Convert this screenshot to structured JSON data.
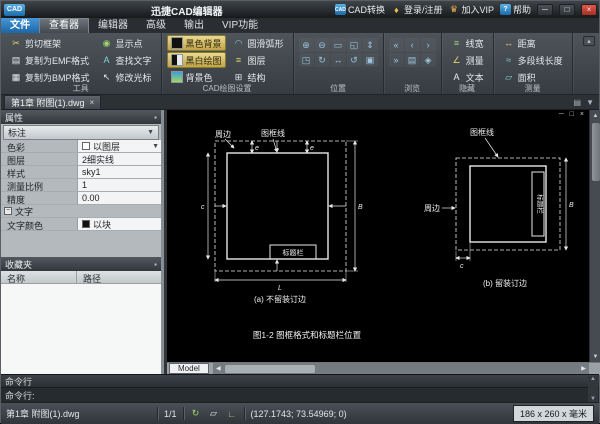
{
  "titlebar": {
    "logo": "CAD",
    "title": "迅捷CAD编辑器",
    "convert": "CAD转换",
    "login": "登录/注册",
    "vip": "加入VIP",
    "help": "帮助"
  },
  "menu": {
    "tabs": [
      {
        "label": "文件"
      },
      {
        "label": "查看器"
      },
      {
        "label": "编辑器"
      },
      {
        "label": "高级"
      },
      {
        "label": "输出"
      },
      {
        "label": "VIP功能"
      }
    ]
  },
  "ribbon": {
    "tools": {
      "caption": "工具",
      "buttons": [
        {
          "label": "剪切框架"
        },
        {
          "label": "复制为EMF格式"
        },
        {
          "label": "复制为BMP格式"
        },
        {
          "label": "显示点"
        },
        {
          "label": "查找文字"
        },
        {
          "label": "修改光标"
        }
      ]
    },
    "cad": {
      "caption": "CAD绘图设置",
      "buttons": [
        {
          "label": "黑色背景"
        },
        {
          "label": "黑白绘图"
        },
        {
          "label": "背景色"
        },
        {
          "label": "圆滑弧形"
        },
        {
          "label": "图层"
        },
        {
          "label": "结构"
        }
      ]
    },
    "position": {
      "caption": "位置"
    },
    "browse": {
      "caption": "浏览"
    },
    "hide": {
      "caption": "隐藏",
      "buttons": [
        {
          "label": "线宽"
        },
        {
          "label": "测量"
        },
        {
          "label": "文本"
        }
      ]
    },
    "measure": {
      "caption": "测量",
      "buttons": [
        {
          "label": "距离"
        },
        {
          "label": "多段线长度"
        },
        {
          "label": "面积"
        }
      ]
    }
  },
  "doc_tab": {
    "label": "第1章 附图(1).dwg"
  },
  "properties": {
    "header": "属性",
    "category": "标注",
    "rows": [
      {
        "label": "色彩",
        "value": "以图层"
      },
      {
        "label": "图层",
        "value": "2细实线"
      },
      {
        "label": "样式",
        "value": "sky1"
      },
      {
        "label": "测量比例",
        "value": "1"
      },
      {
        "label": "精度",
        "value": "0.00"
      }
    ],
    "section": "文字",
    "text_color": {
      "label": "文字颜色",
      "value": "以块"
    }
  },
  "favorites": {
    "header": "收藏夹",
    "col_name": "名称",
    "col_path": "路径"
  },
  "canvas": {
    "labels": {
      "a_margin": "周边",
      "a_frame": "图框线",
      "a_titleblock": "标题栏",
      "a_caption": "(a) 不留装订边",
      "b_frame": "图框线",
      "b_margin": "周边",
      "b_titleblock": "标题栏",
      "b_caption": "(b) 留装订边",
      "figure_caption": "图1-2 图框格式和标题栏位置",
      "dim_e": "e",
      "dim_c": "c",
      "dim_l": "L",
      "dim_b_upper": "B"
    },
    "model_tab": "Model"
  },
  "command": {
    "header": "命令行",
    "prompt": "命令行:"
  },
  "statusbar": {
    "file": "第1章 附图(1).dwg",
    "page": "1/1",
    "coords": "(127.1743; 73.54969; 0)",
    "size": "186 x 260 x 毫米"
  },
  "colors": {
    "accent_blue": "#2f7cc4",
    "highlight_yellow": "#d8c56e",
    "canvas_bg": "#000000",
    "line": "#ffffff"
  },
  "icons": {
    "convert": "CAD",
    "login": "♦",
    "vip": "♛",
    "help": "?",
    "minimize": "─",
    "maximize": "□",
    "close": "×",
    "pin": "▪",
    "chevron_down": "▼",
    "collapse": "▴",
    "tab_close": "×",
    "menu_list": "▤",
    "scissors": "✂",
    "copy_emf": "▤",
    "copy_bmp": "▦",
    "show_points": "◉",
    "find_text": "A",
    "cursor": "↖",
    "smooth_arc": "◠",
    "layers": "≡",
    "structure": "⊞",
    "zoom_in": "⊕",
    "zoom_out": "⊖",
    "zoom_window": "▭",
    "zoom_extents": "◱",
    "pan": "⇕",
    "zoom_all": "◳",
    "zoom_prev": "↻",
    "move": "↔",
    "refresh": "↺",
    "locate": "▣",
    "nav_first": "«",
    "nav_prev": "‹",
    "nav_next": "›",
    "nav_last": "»",
    "pages": "▤",
    "home": "◈",
    "lineweight": "≡",
    "measure_toggle": "∠",
    "text_toggle": "A",
    "distance": "↔",
    "polyline_length": "≈",
    "area": "▱",
    "expander": "−",
    "up": "▲",
    "down": "▼",
    "left": "◀",
    "right": "▶",
    "status_refresh": "↻",
    "status_plane": "▱",
    "status_angle": "∟"
  }
}
